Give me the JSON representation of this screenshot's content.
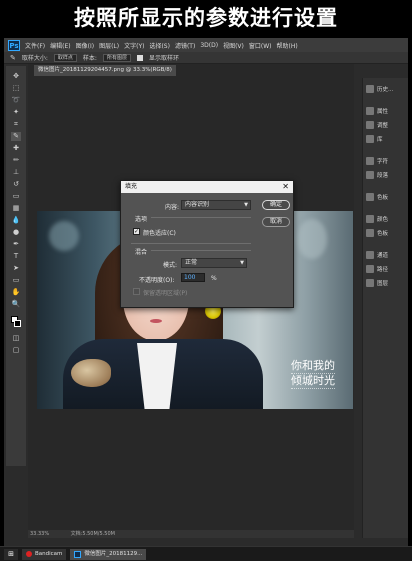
{
  "caption": "按照所显示的参数进行设置",
  "app": {
    "logo": "Ps",
    "menu": [
      "文件(F)",
      "编辑(E)",
      "图像(I)",
      "图层(L)",
      "文字(Y)",
      "选择(S)",
      "滤镜(T)",
      "3D(D)",
      "视图(V)",
      "窗口(W)",
      "帮助(H)"
    ],
    "options": {
      "mode_label": "取样大小:",
      "mode_value": "取样点",
      "sample_label": "样本:",
      "sample_value": "所有图层",
      "show_ring": "显示取样环"
    },
    "doc_tab": "微信图片_20181129204457.png @ 33.3%(RGB/8)",
    "status": {
      "zoom": "33.33%",
      "doc": "文档:5.50M/5.50M"
    },
    "overlay_text": [
      "你和我的",
      "倾城时光"
    ]
  },
  "panels": [
    "历史...",
    "属性",
    "调整",
    "库",
    "字符",
    "段落",
    "色板",
    "颜色",
    "色板",
    "通道",
    "路径",
    "图层"
  ],
  "dialog": {
    "title": "填充",
    "content_label": "内容:",
    "content_value": "内容识别",
    "ok": "确定",
    "cancel": "取消",
    "options_title": "选项",
    "color_adapt": "颜色适应(C)",
    "blend_title": "混合",
    "mode_label": "模式:",
    "mode_value": "正常",
    "opacity_label": "不透明度(O):",
    "opacity_value": "100",
    "opacity_unit": "%",
    "preserve": "保留透明区域(P)"
  },
  "taskbar": {
    "app1": "Bandicam",
    "app2": "微信图片_20181129..."
  },
  "icons": [
    "move-icon",
    "marquee-icon",
    "lasso-icon",
    "magic-wand-icon",
    "crop-icon",
    "eyedropper-icon",
    "healing-icon",
    "brush-icon",
    "stamp-icon",
    "history-brush-icon",
    "eraser-icon",
    "gradient-icon",
    "blur-icon",
    "dodge-icon",
    "pen-icon",
    "type-icon",
    "path-select-icon",
    "shape-icon",
    "hand-icon",
    "zoom-icon",
    "color-swatch-icon",
    "quick-mask-icon",
    "screen-mode-icon"
  ]
}
